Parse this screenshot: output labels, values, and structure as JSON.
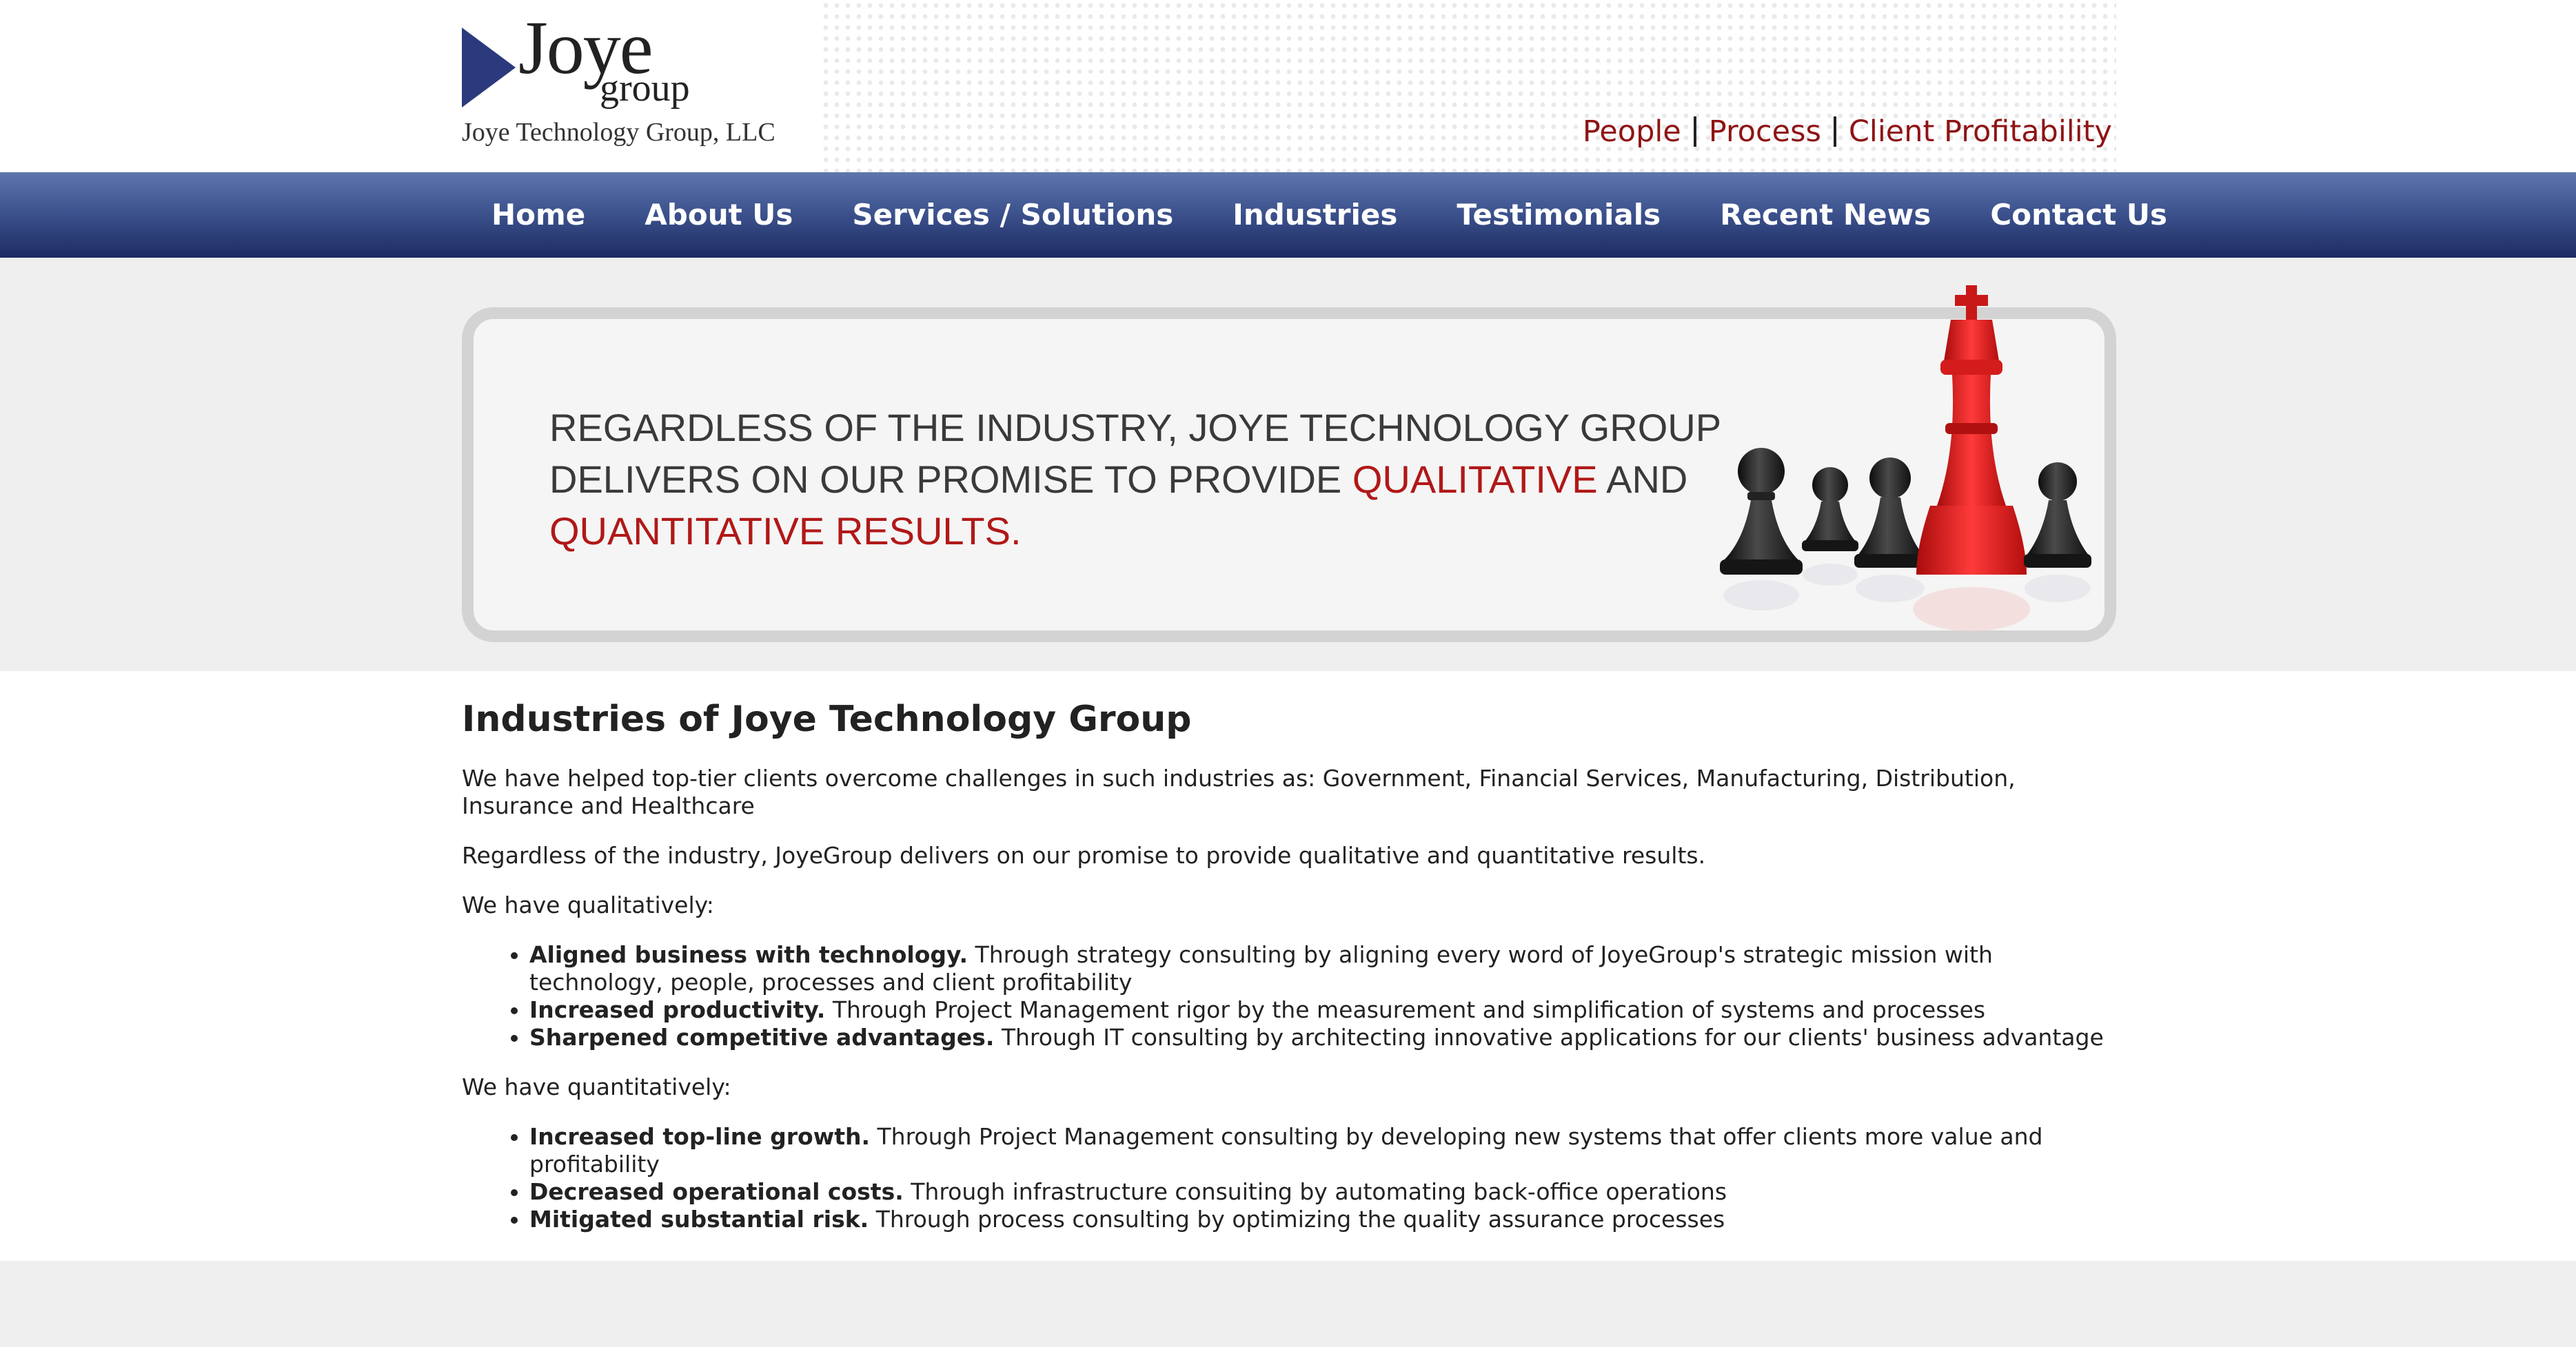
{
  "logo": {
    "brand": "Joye",
    "sub": "group",
    "company": "Joye Technology Group, LLC"
  },
  "tagline": [
    "People",
    "Process",
    "Client Profitability"
  ],
  "nav": [
    "Home",
    "About Us",
    "Services / Solutions",
    "Industries",
    "Testimonials",
    "Recent News",
    "Contact Us"
  ],
  "banner": {
    "line1": "REGARDLESS OF THE INDUSTRY, JOYE TECHNOLOGY GROUP",
    "line2_a": "DELIVERS ON OUR PROMISE TO PROVIDE ",
    "line2_red": "QUALITATIVE",
    "line2_b": " AND",
    "line3_red": "QUANTITATIVE RESULTS."
  },
  "content": {
    "title": "Industries of Joye Technology Group",
    "intro": "We have helped top-tier clients overcome challenges in such industries as: Government, Financial Services, Manufacturing, Distribution, Insurance and Healthcare",
    "promise": "Regardless of the industry, JoyeGroup delivers on our promise to provide qualitative and quantitative results.",
    "qual_heading": "We have qualitatively:",
    "qual": [
      {
        "bold": "Aligned business with technology.",
        "text": " Through strategy consulting by aligning every word of JoyeGroup's strategic mission with technology, people, processes and client profitability"
      },
      {
        "bold": "Increased productivity.",
        "text": " Through Project Management rigor by the measurement and simplification of systems and processes"
      },
      {
        "bold": "Sharpened competitive advantages.",
        "text": " Through IT consulting by architecting innovative applications for our clients' business advantage"
      }
    ],
    "quant_heading": "We have quantitatively:",
    "quant": [
      {
        "bold": "Increased top-line growth.",
        "text": " Through Project Management consulting by developing new systems that offer clients more value and profitability"
      },
      {
        "bold": "Decreased operational costs.",
        "text": " Through infrastructure consuiting by automating back-office operations"
      },
      {
        "bold": "Mitigated substantial risk.",
        "text": " Through process consulting by optimizing the quality assurance processes"
      }
    ]
  },
  "colors": {
    "accent_red": "#8f1414",
    "nav_blue": "#3e548f",
    "logo_blue": "#2b3a7c"
  },
  "icons": [
    "logo-triangle-icon",
    "chess-king-icon",
    "chess-pawn-icon"
  ]
}
